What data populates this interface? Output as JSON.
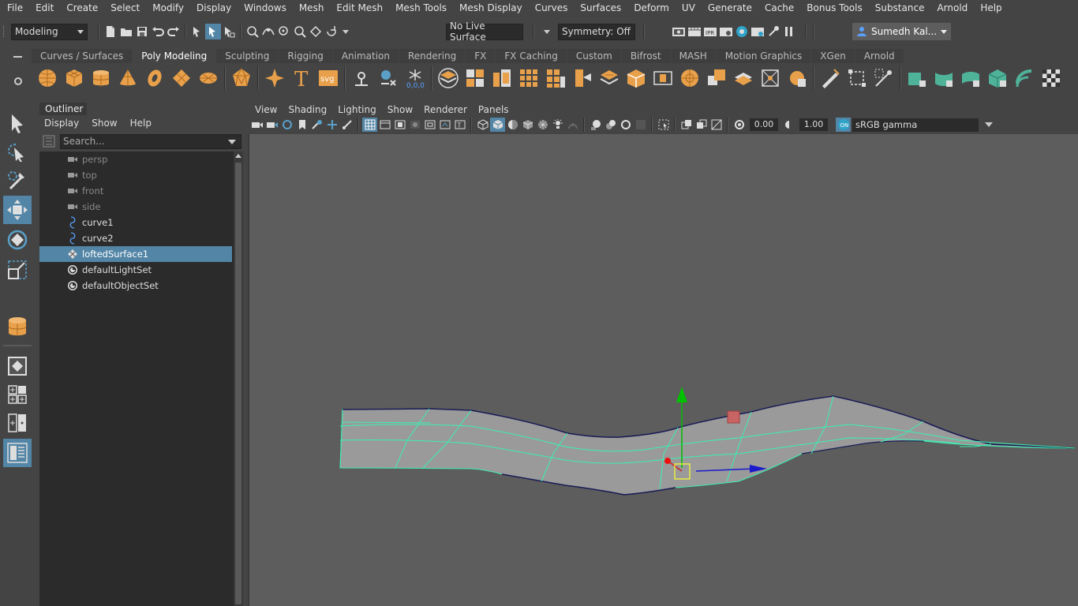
{
  "menubar": {
    "items": [
      "File",
      "Edit",
      "Create",
      "Select",
      "Modify",
      "Display",
      "Windows",
      "Mesh",
      "Edit Mesh",
      "Mesh Tools",
      "Mesh Display",
      "Curves",
      "Surfaces",
      "Deform",
      "UV",
      "Generate",
      "Cache",
      "Bonus Tools",
      "Substance",
      "Arnold",
      "Help"
    ]
  },
  "statusline": {
    "menuset": "Modeling",
    "live_surface": "No Live Surface",
    "symmetry": "Symmetry: Off",
    "user": "Sumedh Kal..."
  },
  "shelf": {
    "tabs": [
      "Curves / Surfaces",
      "Poly Modeling",
      "Sculpting",
      "Rigging",
      "Animation",
      "Rendering",
      "FX",
      "FX Caching",
      "Custom",
      "Bifrost",
      "MASH",
      "Motion Graphics",
      "XGen",
      "Arnold"
    ],
    "active_tab": "Poly Modeling",
    "svg_label": "svg"
  },
  "outliner": {
    "title": "Outliner",
    "menu": [
      "Display",
      "Show",
      "Help"
    ],
    "search_placeholder": "Search...",
    "items": [
      {
        "label": "persp",
        "icon": "camera-icon",
        "dim": true
      },
      {
        "label": "top",
        "icon": "camera-icon",
        "dim": true
      },
      {
        "label": "front",
        "icon": "camera-icon",
        "dim": true
      },
      {
        "label": "side",
        "icon": "camera-icon",
        "dim": true
      },
      {
        "label": "curve1",
        "icon": "curve-icon",
        "dim": false
      },
      {
        "label": "curve2",
        "icon": "curve-icon",
        "dim": false
      },
      {
        "label": "loftedSurface1",
        "icon": "surface-icon",
        "dim": false,
        "selected": true
      },
      {
        "label": "defaultLightSet",
        "icon": "set-icon",
        "dim": false
      },
      {
        "label": "defaultObjectSet",
        "icon": "set-icon",
        "dim": false
      }
    ]
  },
  "viewport": {
    "menu": [
      "View",
      "Shading",
      "Lighting",
      "Show",
      "Renderer",
      "Panels"
    ],
    "exposure": "0.00",
    "gamma": "1.00",
    "color_space": "sRGB gamma",
    "coords_label": "0,0,0"
  },
  "colors": {
    "accent": "#5285a6",
    "shelf_icon": "#e8a04a",
    "shelf_icon_green": "#4fb39a",
    "wire": "#3cf0b0",
    "surface": "#9a9a9a"
  }
}
